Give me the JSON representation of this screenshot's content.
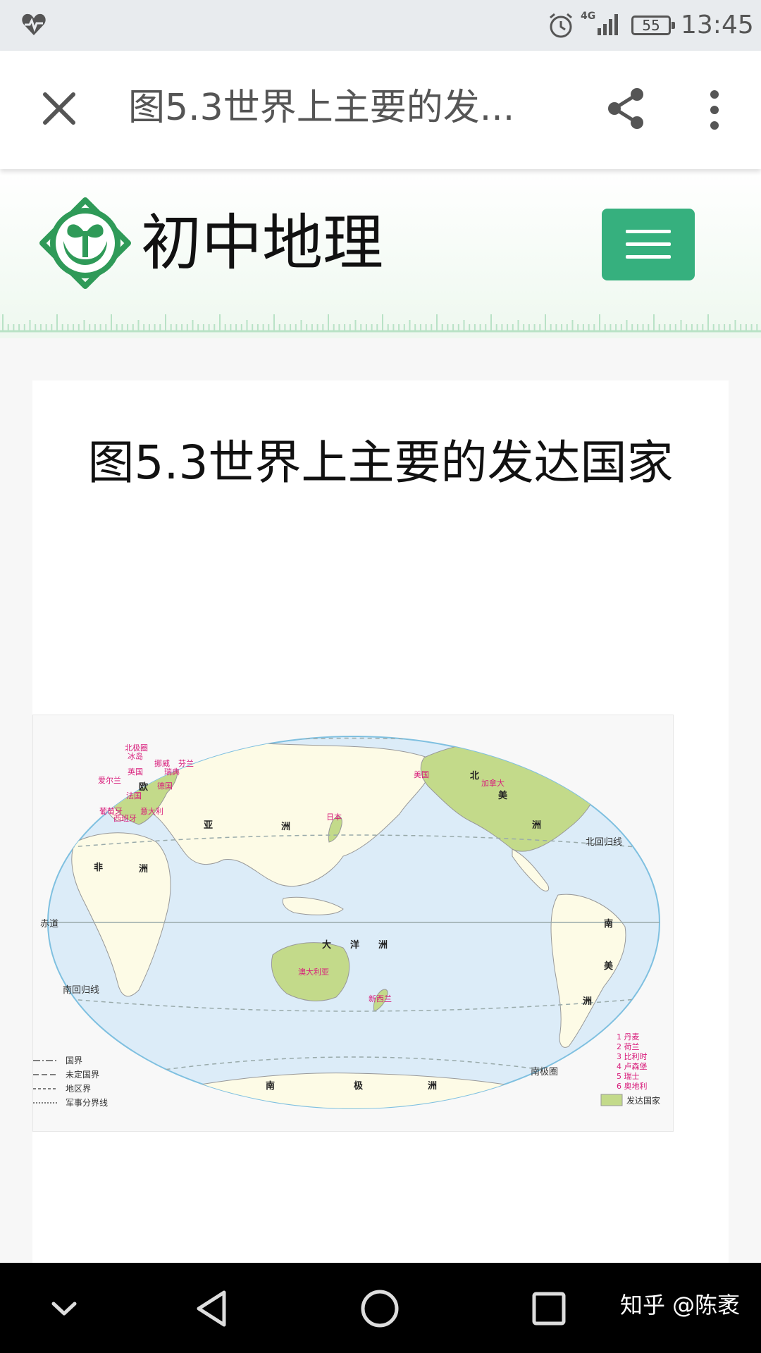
{
  "status_bar": {
    "network": "4G",
    "battery": "55",
    "time": "13:45",
    "icons": [
      "health-heart-icon",
      "alarm-icon",
      "signal-icon",
      "battery-icon"
    ]
  },
  "app_bar": {
    "title": "图5.3世界上主要的发...",
    "icons": [
      "close-icon",
      "share-icon",
      "more-vertical-icon"
    ]
  },
  "site": {
    "title": "初中地理",
    "brand_color": "#36b07e",
    "icons": [
      "site-logo",
      "menu-icon"
    ]
  },
  "article": {
    "heading": "图5.3世界上主要的发达国家"
  },
  "map": {
    "continent_labels": [
      "北",
      "美",
      "洲",
      "亚",
      "洲",
      "非",
      "洲",
      "欧",
      "南",
      "美",
      "洲",
      "南",
      "极",
      "洲",
      "大",
      "洋",
      "洲"
    ],
    "country_labels": [
      "北极圈",
      "冰岛",
      "英国",
      "爱尔兰",
      "挪威",
      "瑞典",
      "芬兰",
      "德国",
      "法国",
      "葡萄牙",
      "西班牙",
      "意大利",
      "日本",
      "美国",
      "加拿大",
      "澳大利亚",
      "新西兰"
    ],
    "lines": [
      "北回归线",
      "赤道",
      "南回归线",
      "南极圈"
    ],
    "boundary_legend": [
      "国界",
      "未定国界",
      "地区界",
      "军事分界线"
    ],
    "numbered_legend": [
      "1 丹麦",
      "2 荷兰",
      "3 比利时",
      "4 卢森堡",
      "5 瑞士",
      "6 奥地利"
    ],
    "color_legend": "发达国家",
    "colors": {
      "ocean": "#dcecf8",
      "land": "#fdfbe6",
      "developed": "#c3da8a",
      "label": "#d81b7a",
      "border": "#7fc0e0"
    }
  },
  "nav_bar": {
    "icons": [
      "collapse-chevron-icon",
      "back-triangle-icon",
      "home-circle-icon",
      "recents-square-icon"
    ],
    "watermark": "知乎 @陈袤"
  }
}
